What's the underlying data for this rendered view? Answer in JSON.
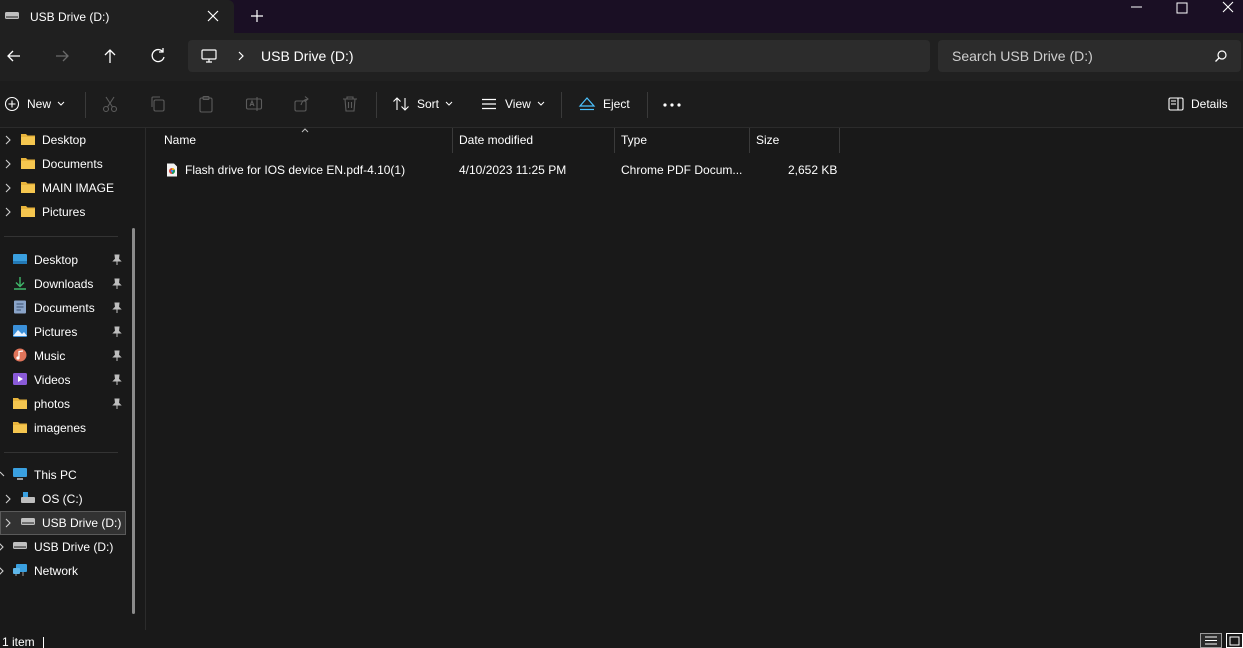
{
  "window": {
    "tab_title": "USB Drive (D:)",
    "tab_icon": "usb-drive-icon"
  },
  "address": {
    "breadcrumb": "USB Drive (D:)",
    "search_placeholder": "Search USB Drive (D:)"
  },
  "toolbar": {
    "new_label": "New",
    "sort_label": "Sort",
    "view_label": "View",
    "eject_label": "Eject",
    "details_label": "Details"
  },
  "sidebar": {
    "tree_items": [
      {
        "label": "Desktop",
        "icon": "folder-icon"
      },
      {
        "label": "Documents",
        "icon": "folder-icon"
      },
      {
        "label": "MAIN IMAGE",
        "icon": "folder-icon"
      },
      {
        "label": "Pictures",
        "icon": "folder-icon"
      }
    ],
    "quick_access": [
      {
        "label": "Desktop",
        "icon": "desktop-icon",
        "pinned": true
      },
      {
        "label": "Downloads",
        "icon": "download-icon",
        "pinned": true
      },
      {
        "label": "Documents",
        "icon": "document-icon",
        "pinned": true
      },
      {
        "label": "Pictures",
        "icon": "pictures-icon",
        "pinned": true
      },
      {
        "label": "Music",
        "icon": "music-icon",
        "pinned": true
      },
      {
        "label": "Videos",
        "icon": "video-icon",
        "pinned": true
      },
      {
        "label": "photos",
        "icon": "folder-icon",
        "pinned": true
      },
      {
        "label": "imagenes",
        "icon": "folder-icon",
        "pinned": false
      }
    ],
    "devices": [
      {
        "label": "This PC",
        "icon": "pc-icon"
      },
      {
        "label": "OS (C:)",
        "icon": "drive-icon"
      },
      {
        "label": "USB Drive (D:)",
        "icon": "usb-drive-icon",
        "selected": true
      },
      {
        "label": "USB Drive (D:)",
        "icon": "usb-drive-icon"
      },
      {
        "label": "Network",
        "icon": "network-icon"
      }
    ]
  },
  "file_list": {
    "columns": [
      "Name",
      "Date modified",
      "Type",
      "Size"
    ],
    "rows": [
      {
        "name": "Flash drive for IOS device  EN.pdf-4.10(1)",
        "date_modified": "4/10/2023 11:25 PM",
        "type": "Chrome PDF Docum...",
        "size": "2,652 KB",
        "icon": "chrome-pdf-icon"
      }
    ]
  },
  "status": {
    "item_count": "1 item"
  },
  "colors": {
    "background": "#191919",
    "titlebar": "#1a0f24",
    "folder": "#e8b43c",
    "accent": "#4cc2ff"
  }
}
